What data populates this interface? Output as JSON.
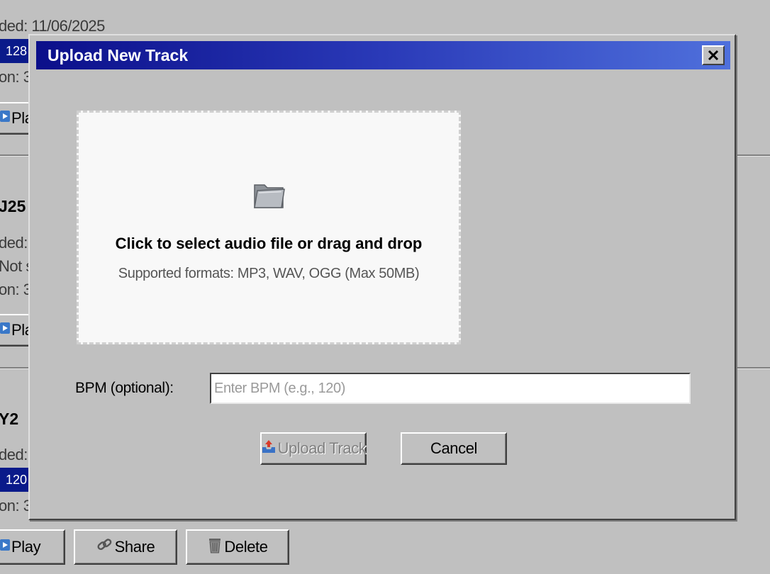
{
  "background": {
    "items": [
      {
        "uploaded_text": "ded: 11/06/2025",
        "bpm": "128",
        "duration_text": "on: 3",
        "play_label": "Pla"
      },
      {
        "title": "J25",
        "uploaded_text": "ded:",
        "status_text": "Not s",
        "duration_text": "on: 3",
        "play_label": "Pla"
      },
      {
        "title": "Y2",
        "uploaded_text": "ded:",
        "bpm": "120",
        "duration_text": "on: 3",
        "play_label": "Play",
        "share_label": "Share",
        "delete_label": "Delete"
      }
    ]
  },
  "dialog": {
    "title": "Upload New Track",
    "close_icon": "close-icon",
    "dropzone": {
      "icon": "folder-icon",
      "title": "Click to select audio file or drag and drop",
      "subtitle": "Supported formats: MP3, WAV, OGG (Max 50MB)"
    },
    "bpm": {
      "label": "BPM (optional):",
      "placeholder": "Enter BPM (e.g., 120)",
      "value": ""
    },
    "buttons": {
      "upload_label": "Upload Track",
      "upload_icon": "upload-icon",
      "upload_disabled": true,
      "cancel_label": "Cancel"
    }
  },
  "colors": {
    "title_gradient_start": "#0b0f8a",
    "title_gradient_end": "#4f70dc",
    "bpm_badge": "#0a1a8a",
    "window_bg": "#c0c0c0"
  }
}
